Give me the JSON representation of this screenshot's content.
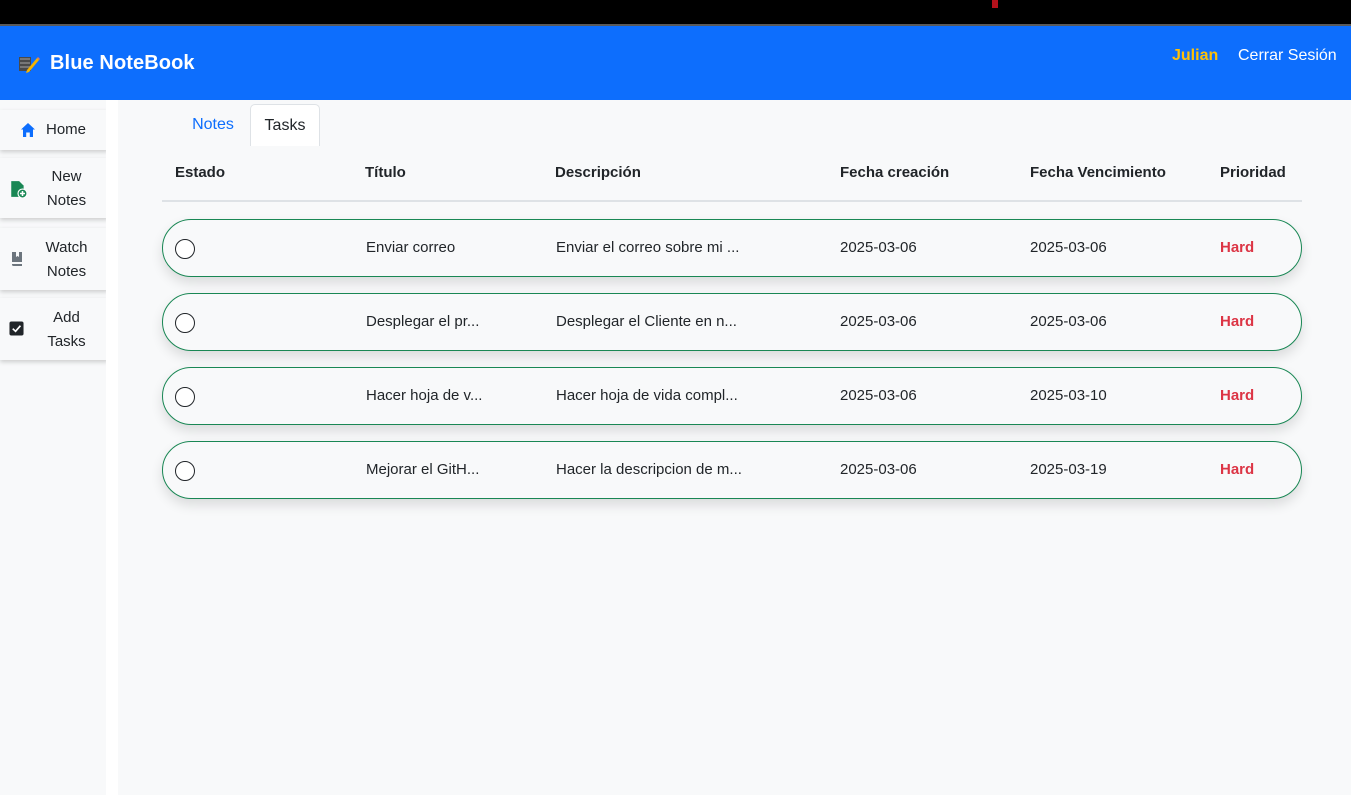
{
  "navbar": {
    "brand": "Blue NoteBook",
    "user": "Julian",
    "logout": "Cerrar Sesión"
  },
  "sidebar": {
    "items": [
      {
        "line1": "Home",
        "line2": "",
        "icon": "home-icon"
      },
      {
        "line1": "New",
        "line2": "Notes",
        "icon": "file-plus-icon"
      },
      {
        "line1": "Watch",
        "line2": "Notes",
        "icon": "book-icon"
      },
      {
        "line1": "Add",
        "line2": "Tasks",
        "icon": "checkbox-icon"
      }
    ]
  },
  "tabs": [
    {
      "label": "Notes"
    },
    {
      "label": "Tasks"
    }
  ],
  "table": {
    "headers": [
      "Estado",
      "Título",
      "Descripción",
      "Fecha creación",
      "Fecha Vencimiento",
      "Prioridad"
    ],
    "rows": [
      {
        "titulo": "Enviar correo",
        "descripcion": "Enviar el correo sobre mi ...",
        "creacion": "2025-03-06",
        "vencimiento": "2025-03-06",
        "prioridad": "Hard"
      },
      {
        "titulo": "Desplegar el pr...",
        "descripcion": "Desplegar el Cliente en n...",
        "creacion": "2025-03-06",
        "vencimiento": "2025-03-06",
        "prioridad": "Hard"
      },
      {
        "titulo": "Hacer hoja de v...",
        "descripcion": "Hacer hoja de vida compl...",
        "creacion": "2025-03-06",
        "vencimiento": "2025-03-10",
        "prioridad": "Hard"
      },
      {
        "titulo": "Mejorar el GitH...",
        "descripcion": "Hacer la descripcion de m...",
        "creacion": "2025-03-06",
        "vencimiento": "2025-03-19",
        "prioridad": "Hard"
      }
    ]
  },
  "colors": {
    "primary": "#0d6efd",
    "user": "#ffc107",
    "success_border": "#198754",
    "priority_hard": "#dc3545"
  }
}
